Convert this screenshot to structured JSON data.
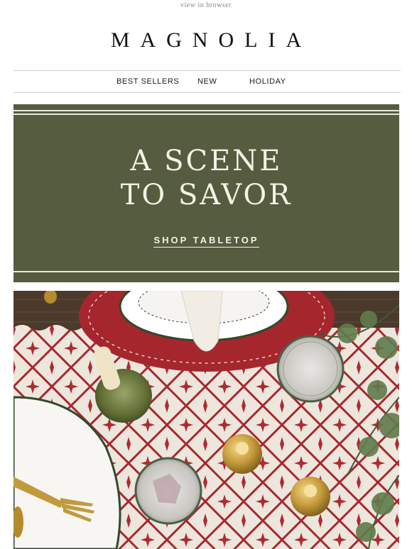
{
  "header": {
    "view_in_browser": "view in browser",
    "logo": "MAGNOLIA"
  },
  "nav": {
    "items": [
      {
        "label": "BEST SELLERS"
      },
      {
        "label": "NEW"
      },
      {
        "label": "HOLIDAY"
      }
    ]
  },
  "hero": {
    "headline_line1": "A SCENE",
    "headline_line2": "TO SAVOR",
    "cta_label": "SHOP TABLETOP",
    "bg_color": "#555c3f"
  },
  "photo": {
    "subject": "tabletop-scene"
  }
}
